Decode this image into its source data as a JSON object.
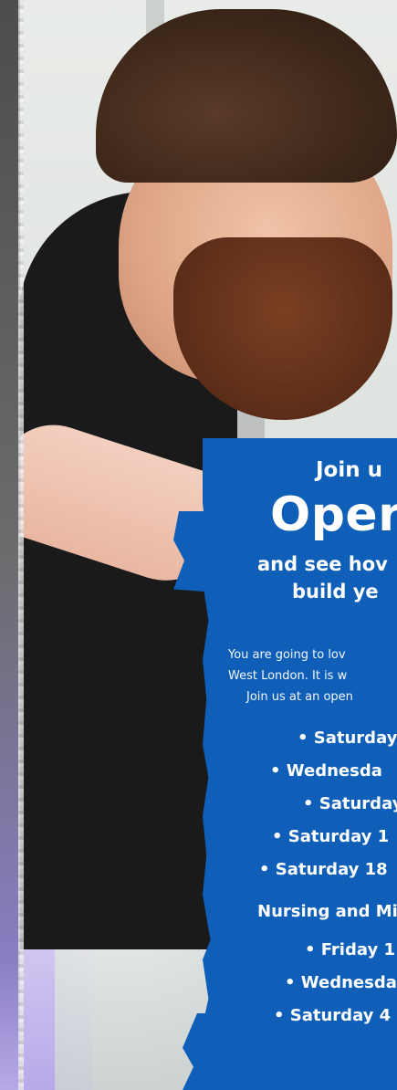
{
  "promo": {
    "join": "Join u",
    "headline": "Oper",
    "sub_line1": "and see hov",
    "sub_line2": "build ye",
    "para_line1": "You are going to lov",
    "para_line2": "West London. It is w",
    "para_line3": "Join us at an open",
    "dates": [
      "• Saturday",
      "• Wednesda",
      "• Saturday",
      "• Saturday 1",
      "• Saturday 18"
    ],
    "nursing_heading": "Nursing and Mi",
    "nursing_dates": [
      "• Friday 1",
      "• Wednesda",
      "• Saturday 4"
    ]
  },
  "colors": {
    "promo_blue": "#0f5fb8",
    "text": "#ffffff"
  }
}
